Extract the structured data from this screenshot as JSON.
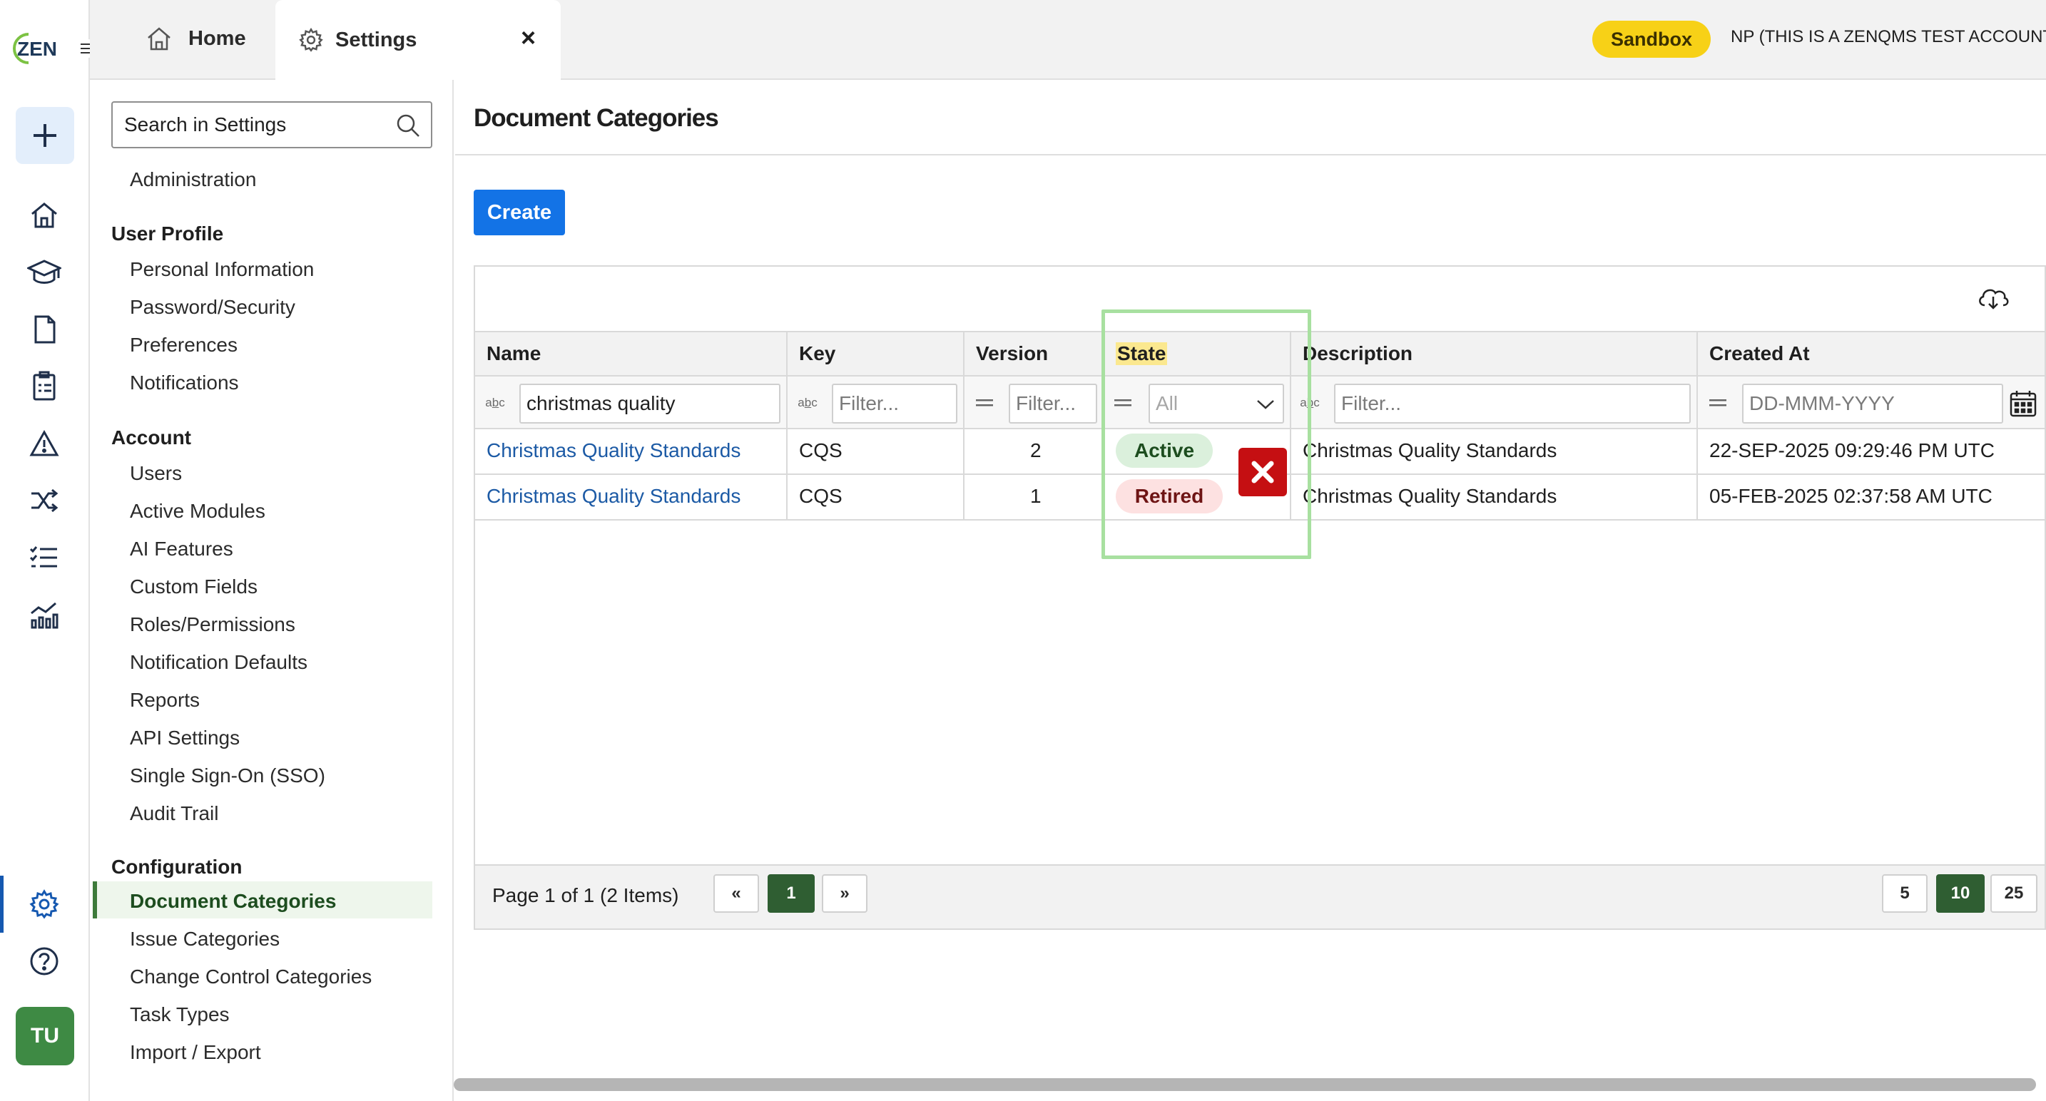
{
  "topbar": {
    "tabs": [
      {
        "label": "Home",
        "icon": "home-icon"
      },
      {
        "label": "Settings",
        "icon": "gear-icon",
        "close": "×"
      }
    ],
    "environment_badge": "Sandbox",
    "account_name": "NP (THIS IS A ZENQMS TEST ACCOUNT)"
  },
  "rail": {
    "logo_text": "ZEN",
    "avatar_initials": "TU"
  },
  "sidebar": {
    "search_placeholder": "Search in Settings",
    "top_item": "Administration",
    "sections": [
      {
        "heading": "User Profile",
        "items": [
          "Personal Information",
          "Password/Security",
          "Preferences",
          "Notifications"
        ]
      },
      {
        "heading": "Account",
        "items": [
          "Users",
          "Active Modules",
          "AI Features",
          "Custom Fields",
          "Roles/Permissions",
          "Notification Defaults",
          "Reports",
          "API Settings",
          "Single Sign-On (SSO)",
          "Audit Trail"
        ]
      },
      {
        "heading": "Configuration",
        "items": [
          "Document Categories",
          "Issue Categories",
          "Change Control Categories",
          "Task Types",
          "Import / Export"
        ]
      }
    ],
    "active_item": "Document Categories"
  },
  "main": {
    "title": "Document Categories",
    "create_label": "Create",
    "columns": [
      "Name",
      "Key",
      "Version",
      "State",
      "Description",
      "Created At"
    ],
    "filters": {
      "name_value": "christmas quality",
      "key_placeholder": "Filter...",
      "version_placeholder": "Filter...",
      "state_selected": "All",
      "description_placeholder": "Filter...",
      "created_placeholder": "DD-MMM-YYYY"
    },
    "rows": [
      {
        "name": "Christmas Quality Standards",
        "key": "CQS",
        "version": "2",
        "state": "Active",
        "description": "Christmas Quality Standards",
        "created_at": "22-SEP-2025 09:29:46 PM UTC"
      },
      {
        "name": "Christmas Quality Standards",
        "key": "CQS",
        "version": "1",
        "state": "Retired",
        "description": "Christmas Quality Standards",
        "created_at": "05-FEB-2025 02:37:58 AM UTC"
      }
    ],
    "pager": {
      "summary": "Page 1 of 1 (2 Items)",
      "prev": "«",
      "current_page": "1",
      "next": "»",
      "page_sizes": [
        "5",
        "10",
        "25"
      ],
      "active_page_size": "10"
    }
  },
  "colors": {
    "primary": "#1373e6",
    "active_green": "#2f5e32",
    "sandbox_yellow": "#f7d117",
    "annotation_box": "#a8e0a0",
    "annotation_x": "#c50f12"
  }
}
